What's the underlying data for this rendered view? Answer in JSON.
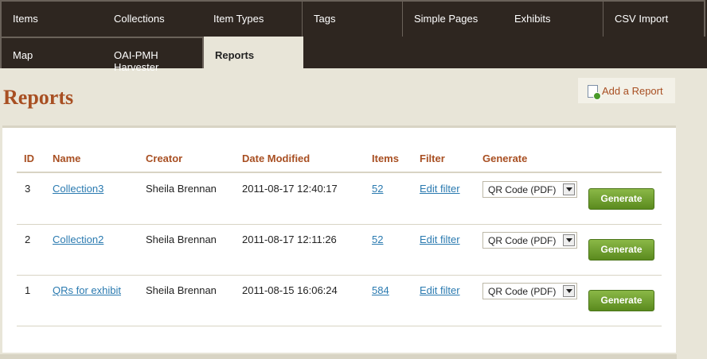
{
  "nav": {
    "row1": [
      "Items",
      "Collections",
      "Item Types",
      "Tags",
      "Simple Pages",
      "Exhibits",
      "CSV Import"
    ],
    "row2": [
      "Map",
      "OAI-PMH Harvester",
      "Reports"
    ],
    "active": "Reports"
  },
  "page_title": "Reports",
  "add_report_label": "Add a Report",
  "table": {
    "headers": {
      "id": "ID",
      "name": "Name",
      "creator": "Creator",
      "date": "Date Modified",
      "items": "Items",
      "filter": "Filter",
      "generate": "Generate"
    },
    "rows": [
      {
        "id": "3",
        "name": "Collection3",
        "creator": "Sheila Brennan",
        "date": "2011-08-17 12:40:17",
        "items": "52",
        "filter": "Edit filter",
        "format": "QR Code (PDF)",
        "button": "Generate"
      },
      {
        "id": "2",
        "name": "Collection2",
        "creator": "Sheila Brennan",
        "date": "2011-08-17 12:11:26",
        "items": "52",
        "filter": "Edit filter",
        "format": "QR Code (PDF)",
        "button": "Generate"
      },
      {
        "id": "1",
        "name": "QRs for exhibit",
        "creator": "Sheila Brennan",
        "date": "2011-08-15 16:06:24",
        "items": "584",
        "filter": "Edit filter",
        "format": "QR Code (PDF)",
        "button": "Generate"
      }
    ]
  },
  "colors": {
    "accent": "#a84f22",
    "link": "#2a7ab0",
    "nav_bg": "#2e2620",
    "button": "#6a9a2a"
  }
}
